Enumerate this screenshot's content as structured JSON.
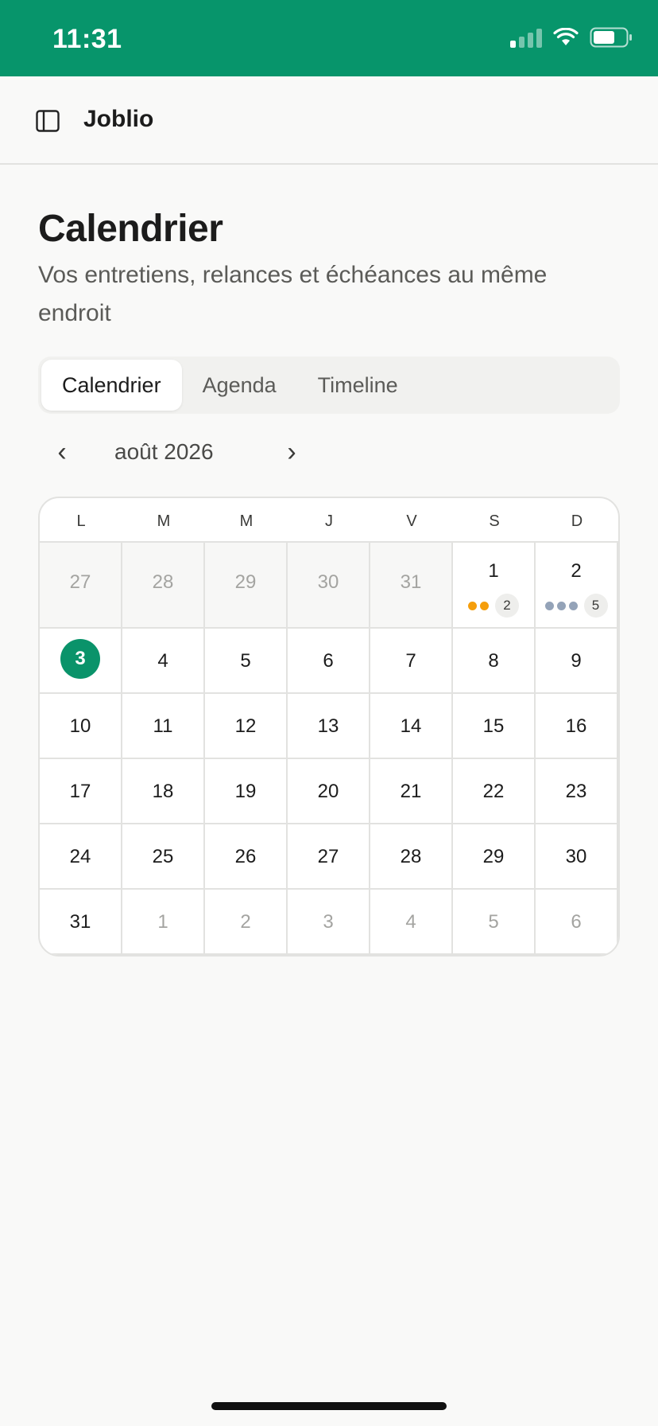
{
  "status_bar": {
    "time": "11:31",
    "signal_icon": "cellular-signal-icon",
    "wifi_icon": "wifi-icon",
    "battery_icon": "battery-icon"
  },
  "header": {
    "app_name": "Joblio",
    "sidebar_icon": "sidebar-toggle-icon"
  },
  "page": {
    "title": "Calendrier",
    "subtitle": "Vos entretiens, relances et échéances au même endroit"
  },
  "tabs": [
    {
      "label": "Calendrier",
      "active": true
    },
    {
      "label": "Agenda",
      "active": false
    },
    {
      "label": "Timeline",
      "active": false
    }
  ],
  "month_nav": {
    "prev": "‹",
    "label": "août 2026",
    "next": "›"
  },
  "calendar": {
    "weekdays": [
      "L",
      "M",
      "M",
      "J",
      "V",
      "S",
      "D"
    ],
    "today": "3",
    "weeks": [
      [
        "27",
        "28",
        "29",
        "30",
        "31",
        "1",
        "2"
      ],
      [
        "3",
        "4",
        "5",
        "6",
        "7",
        "8",
        "9"
      ],
      [
        "10",
        "11",
        "12",
        "13",
        "14",
        "15",
        "16"
      ],
      [
        "17",
        "18",
        "19",
        "20",
        "21",
        "22",
        "23"
      ],
      [
        "24",
        "25",
        "26",
        "27",
        "28",
        "29",
        "30"
      ],
      [
        "31",
        "1",
        "2",
        "3",
        "4",
        "5",
        "6"
      ]
    ],
    "events": [
      {
        "day": "1",
        "dot_colors": [
          "#f59e0b",
          "#f59e0b"
        ],
        "count": "2"
      },
      {
        "day": "2",
        "dot_colors": [
          "#94a3b8",
          "#94a3b8",
          "#94a3b8"
        ],
        "count": "5"
      }
    ]
  },
  "colors": {
    "brand": "#07956b",
    "today": "#0a936a"
  }
}
